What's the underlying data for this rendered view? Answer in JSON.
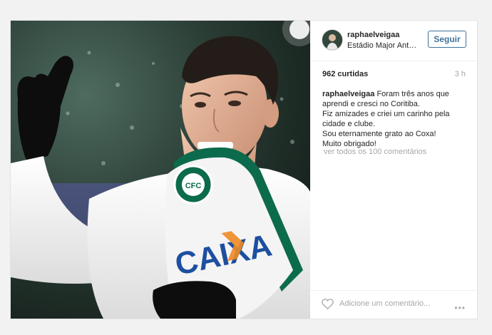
{
  "post": {
    "username": "raphaelveigaa",
    "location": "Estádio Major Antônio Couto Pereira",
    "follow_label": "Seguir",
    "likes": "962 curtidas",
    "time": "3 h",
    "caption_user": "raphaelveigaa",
    "caption_lines": [
      "Foram três anos que",
      "aprendi e cresci no Coritiba.",
      "Fiz amizades e criei um carinho pela",
      "cidade e clube.",
      "Sou eternamente grato ao Coxa!",
      "Muito obrigado!"
    ],
    "view_all": "ver todos os 100 comentários",
    "comment_placeholder": "Adicione um comentário...",
    "more": "•••"
  },
  "photo": {
    "shirt_text": "CAIXA",
    "crest_text": "CFC"
  },
  "colors": {
    "follow_blue": "#3f729b",
    "muted_gray": "#a5a7aa",
    "caixa_blue": "#1d4fa0",
    "caixa_orange": "#f08a24",
    "coritiba_green": "#0c6b4c"
  },
  "icons": {
    "heart": "heart-icon",
    "more": "more-options-icon"
  }
}
